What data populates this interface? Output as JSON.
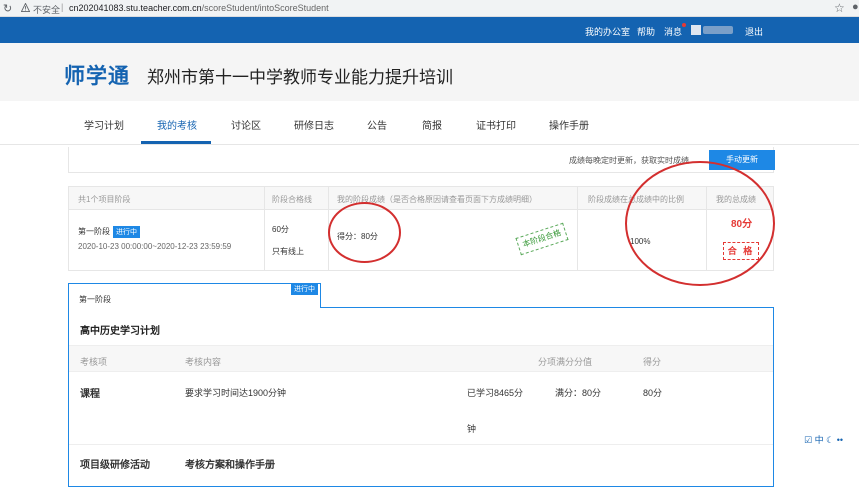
{
  "browser": {
    "reload_icon": "reload-icon",
    "security": "不安全",
    "url_host": "cn202041083.stu.teacher.com.cn",
    "url_path": "/scoreStudent/intoScoreStudent",
    "star_icon": "star-icon"
  },
  "topbar": {
    "office": "我的办公室",
    "help": "帮助",
    "messages": "消息",
    "logout": "退出",
    "bg_color": "#1463b1"
  },
  "header": {
    "logo": "师学通",
    "title": "郑州市第十一中学教师专业能力提升培训"
  },
  "nav": {
    "items": [
      "学习计划",
      "我的考核",
      "讨论区",
      "研修日志",
      "公告",
      "简报",
      "证书打印",
      "操作手册"
    ],
    "active": "我的考核"
  },
  "notice": {
    "text": "成绩每晚定时更新，获取实时成绩",
    "button": "手动更新"
  },
  "stage_table": {
    "headers": [
      "共1个项目阶段",
      "阶段合格线",
      "我的阶段成绩（是否合格原因请查看页面下方成绩明细）",
      "阶段成绩在总成绩中的比例",
      "我的总成绩"
    ],
    "stage_name": "第一阶段",
    "stage_status": "进行中",
    "stage_period": "2020-10-23 00:00:00~2020-12-23 23:59:59",
    "pass_line": "60分",
    "pass_line_note": "只有线上",
    "stage_score": "得分：80分",
    "stage_stamp": "本阶段合格",
    "ratio": "100%",
    "total_score": "80分",
    "total_result": "合 格"
  },
  "detail": {
    "tab_label": "第一阶段",
    "tab_badge": "进行中",
    "plan_title": "高中历史学习计划",
    "headers": {
      "item": "考核项",
      "content": "考核内容",
      "full_score": "分项满分分值",
      "score": "得分"
    },
    "rows": [
      {
        "item": "课程",
        "content": "要求学习时间达1900分钟",
        "progress_line1": "已学习8465分",
        "progress_line2": "钟",
        "full": "满分：80分",
        "score": "80分"
      },
      {
        "item": "项目级研修活动",
        "content": "考核方案和操作手册"
      }
    ]
  },
  "ime": {
    "label": "中"
  }
}
